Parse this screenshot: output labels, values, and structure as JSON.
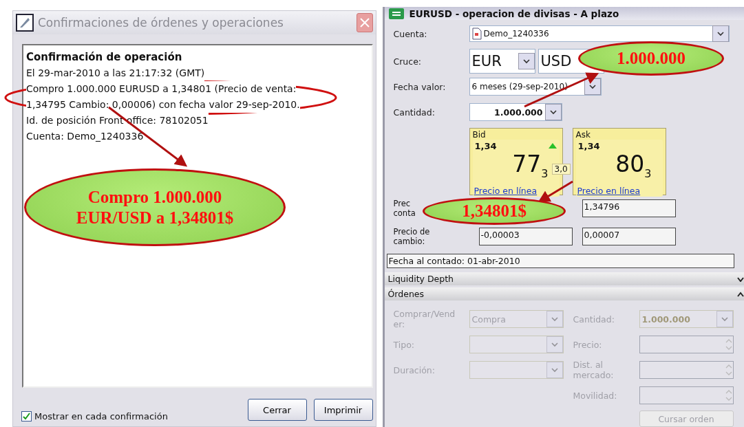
{
  "confirm_window": {
    "title": "Confirmaciones de órdenes y operaciones",
    "heading": "Confirmación de operación",
    "lines": [
      "El 29-mar-2010 a las 21:17:32 (GMT)",
      "Compro 1.000.000 EURUSD a 1,34801 (Precio de venta:",
      "1,34795 Cambio: 0,00006) con fecha valor 29-sep-2010.",
      "Id. de posición Front office: 78102051",
      "Cuenta: Demo_1240336"
    ],
    "show_each": {
      "label": "Mostrar en cada confirmación",
      "checked": true
    },
    "buttons": [
      "Cerrar",
      "Imprimir"
    ]
  },
  "trade_window": {
    "title": "EURUSD - operacion de divisas - A plazo",
    "account": {
      "label": "Cuenta:",
      "value": "Demo_1240336"
    },
    "cross": {
      "label": "Cruce:",
      "base": "EUR",
      "quote": "USD"
    },
    "value_date": {
      "label": "Fecha valor:",
      "value": "6 meses (29-sep-2010)"
    },
    "quantity": {
      "label": "Cantidad:",
      "value": "1.000.000"
    },
    "quotes": [
      {
        "side": "Bid",
        "big_figure": "1,34",
        "pips": "77$_{3}$",
        "tick_up": true,
        "link": "Precio en línea"
      },
      {
        "side": "Ask",
        "big_figure": "1,34",
        "pips": "80$_{3}$",
        "tick_up": false,
        "link": "Precio en línea"
      }
    ],
    "spread": "3,0",
    "price_rows": [
      {
        "label_lines": [
          "Prec",
          "conta"
        ],
        "ask": "1,34796"
      },
      {
        "label_lines": [
          "Precio de",
          "cambio:"
        ],
        "bid": "-0,00003",
        "ask": "0,00007"
      }
    ],
    "spot_date": "Fecha al contado: 01-abr-2010",
    "sections": [
      {
        "title": "Liquidity Depth",
        "expanded": false
      },
      {
        "title": "Órdenes",
        "expanded": true
      }
    ],
    "order_form_disabled": true,
    "order_rows": [
      {
        "left": {
          "label": "Comprar/Vender:",
          "kind": "dropdown",
          "value": "Compra"
        },
        "right": {
          "label": "Cantidad:",
          "kind": "dropdown",
          "value": "1.000.000"
        }
      },
      {
        "left": {
          "label": "Tipo:",
          "kind": "dropdown"
        },
        "right": {
          "label": "Precio:",
          "kind": "spinner"
        }
      },
      {
        "left": {
          "label": "Duración:",
          "kind": "dropdown"
        },
        "right": {
          "label": "Dist. al mercado:",
          "kind": "spinner"
        }
      },
      {
        "right": {
          "label": "Movilidad:",
          "kind": "spinner"
        }
      }
    ],
    "order_button": {
      "label": "Cursar orden",
      "disabled": true
    }
  },
  "annotations": {
    "callouts": [
      {
        "lines": [
          "Compro 1.000.000",
          "EUR/USD a 1,34801$"
        ]
      },
      {
        "lines": [
          "1.000.000"
        ]
      },
      {
        "lines": [
          "1,34801$"
        ]
      }
    ]
  }
}
